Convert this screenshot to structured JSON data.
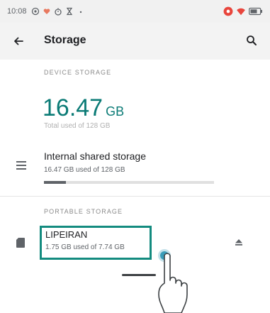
{
  "status_bar": {
    "time": "10:08",
    "icons": [
      "alert-icon",
      "heart-icon",
      "timer-icon",
      "hourglass-icon",
      "dot-icon",
      "record-icon",
      "wifi-icon",
      "battery-icon"
    ]
  },
  "app_bar": {
    "title": "Storage",
    "back_icon": "arrow-left-icon",
    "search_icon": "search-icon"
  },
  "device_storage": {
    "section_label": "DEVICE STORAGE",
    "used_value": "16.47",
    "used_unit": "GB",
    "total_text": "Total used of 128 GB"
  },
  "internal_storage": {
    "title": "Internal shared storage",
    "subtitle": "16.47 GB used of 128 GB",
    "usage_fraction": 0.129,
    "icon": "list-icon"
  },
  "portable_storage": {
    "section_label": "PORTABLE STORAGE",
    "name": "LIPEIRAN",
    "subtitle": "1.75 GB used of 7.74 GB",
    "icon": "sd-card-icon",
    "eject_icon": "eject-icon"
  },
  "colors": {
    "accent": "#0b7b76",
    "highlight": "#138b7f",
    "status_bar_bg": "#f1f1f1"
  }
}
